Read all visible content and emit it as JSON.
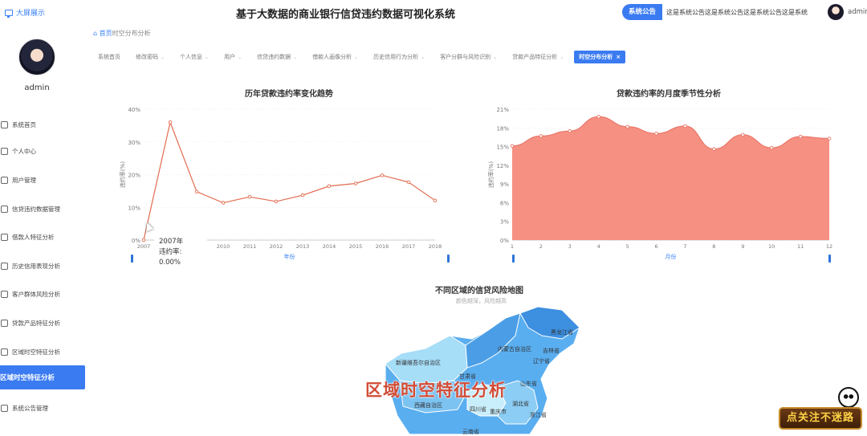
{
  "header": {
    "bigscreen_label": "大屏展示",
    "system_title": "基于大数据的商业银行信贷违约数据可视化系统",
    "announce_label": "系统公告",
    "announce_text": "这是系统公告这是系统公告这是系统公告这是系统",
    "user": "admin"
  },
  "sidebar": {
    "username": "admin",
    "items": [
      {
        "label": "系统首页",
        "icon": "home-icon"
      },
      {
        "label": "个人中心",
        "icon": "user-icon"
      },
      {
        "label": "用户管理",
        "icon": "users-icon"
      },
      {
        "label": "信贷违约数据管理",
        "icon": "clock-icon"
      },
      {
        "label": "借款人特征分析",
        "icon": "id-card-icon"
      },
      {
        "label": "历史信用表现分析",
        "icon": "history-icon"
      },
      {
        "label": "客户群体风险分析",
        "icon": "group-icon"
      },
      {
        "label": "贷款产品特征分析",
        "icon": "checkbox-icon"
      },
      {
        "label": "区域时空特征分析",
        "icon": "monitor-icon"
      },
      {
        "label": "区域时空特征分析",
        "icon": "",
        "active": true
      },
      {
        "label": "系统公告管理",
        "icon": "notice-icon"
      }
    ]
  },
  "breadcrumb": {
    "home": "首页",
    "current": "时空分布分析"
  },
  "tabs": [
    {
      "label": "系统首页",
      "arrow": false
    },
    {
      "label": "修改密码",
      "arrow": true
    },
    {
      "label": "个人信息",
      "arrow": true
    },
    {
      "label": "用户",
      "arrow": true
    },
    {
      "label": "信贷违约数据",
      "arrow": true
    },
    {
      "label": "借款人画像分析",
      "arrow": true
    },
    {
      "label": "历史信用行为分析",
      "arrow": true
    },
    {
      "label": "客户分群与风险识别",
      "arrow": true
    },
    {
      "label": "贷款产品特征分析",
      "arrow": true
    },
    {
      "label": "时空分布分析",
      "active": true,
      "close": "×"
    }
  ],
  "tooltip": {
    "year": "2007年",
    "text": "违约率: 0.00%"
  },
  "map": {
    "title": "不同区域的信贷风险地图",
    "subtitle": "颜色越深，风险越高",
    "provinces": [
      "黑龙江省",
      "吉林省",
      "辽宁省",
      "内蒙古自治区",
      "新疆维吾尔自治区",
      "甘肃省",
      "山东省",
      "西藏自治区",
      "四川省",
      "重庆市",
      "湖北省",
      "浙江省",
      "云南省"
    ]
  },
  "overlay_title": "区域时空特征分析",
  "badge_text": "点关注不迷路",
  "colors": {
    "accent": "#3b7bf2",
    "line": "#e26a4f",
    "area": "#f58a7b",
    "map": "#4aa3e6"
  },
  "chart_data": [
    {
      "type": "line",
      "title": "历年贷款违约率变化趋势",
      "xlabel": "年份",
      "ylabel": "违约率(%)",
      "categories": [
        "2007",
        "2008",
        "2009",
        "2010",
        "2011",
        "2012",
        "2013",
        "2014",
        "2015",
        "2016",
        "2017",
        "2018"
      ],
      "values": [
        0,
        36,
        14.8,
        11.4,
        13.2,
        11.8,
        13.7,
        16.5,
        17.3,
        19.8,
        17.7,
        12.1
      ],
      "ylim": [
        0,
        40
      ],
      "yticks": [
        "0%",
        "10%",
        "20%",
        "30%",
        "40%"
      ]
    },
    {
      "type": "area",
      "title": "贷款违约率的月度季节性分析",
      "xlabel": "月份",
      "ylabel": "违约率(%)",
      "categories": [
        "1",
        "2",
        "3",
        "4",
        "5",
        "6",
        "7",
        "8",
        "9",
        "10",
        "11",
        "12"
      ],
      "values": [
        15.1,
        16.7,
        17.5,
        19.8,
        18.2,
        17.1,
        18.3,
        14.6,
        16.9,
        14.8,
        16.6,
        16.3
      ],
      "ylim": [
        0,
        21
      ],
      "yticks": [
        "0%",
        "3%",
        "6%",
        "9%",
        "12%",
        "15%",
        "18%",
        "21%"
      ]
    }
  ]
}
